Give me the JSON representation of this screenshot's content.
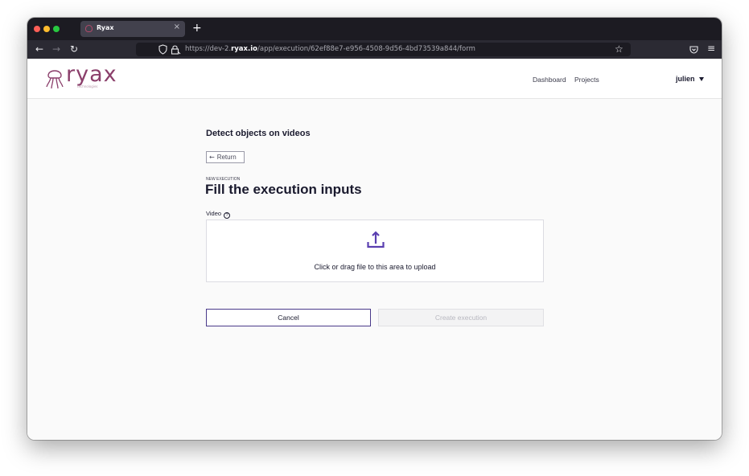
{
  "browser": {
    "tab_title": "Ryax",
    "tab_close": "×",
    "new_tab": "+",
    "url_prefix": "https://dev-2.",
    "url_domain": "ryax.io",
    "url_path": "/app/execution/62ef88e7-e956-4508-9d56-4bd73539a844/form"
  },
  "header": {
    "logo_text": "ryax",
    "logo_tagline": "technologies",
    "nav": [
      "Dashboard",
      "Projects"
    ],
    "user": "julien"
  },
  "main": {
    "workflow_title": "Detect objects on videos",
    "return_label": "Return",
    "eyebrow": "NEW EXECUTION",
    "page_title": "Fill the execution inputs",
    "field_label": "Video",
    "help_glyph": "?",
    "upload_hint": "Click or drag file to this area to upload",
    "cancel_label": "Cancel",
    "create_label": "Create execution",
    "create_disabled": true
  },
  "colors": {
    "brand": "#8b3f6b",
    "accent": "#5a3fb0"
  },
  "icons": [
    "back-icon",
    "forward-icon",
    "reload-icon",
    "home-icon",
    "shield-icon",
    "lock-icon",
    "bookmark-star-icon",
    "pocket-icon",
    "menu-icon",
    "upload-icon",
    "help-icon",
    "arrow-left-icon",
    "caret-down-icon"
  ]
}
